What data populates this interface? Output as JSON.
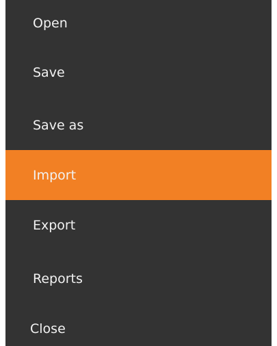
{
  "menu": {
    "items": [
      {
        "label": "Open",
        "selected": false
      },
      {
        "label": "Save",
        "selected": false
      },
      {
        "label": "Save as",
        "selected": false
      },
      {
        "label": "Import",
        "selected": true
      },
      {
        "label": "Export",
        "selected": false
      },
      {
        "label": "Reports",
        "selected": false
      },
      {
        "label": "Close",
        "selected": false
      }
    ]
  },
  "colors": {
    "panel_background": "#333333",
    "selected_background": "#f28024",
    "text": "#f2f2f2"
  }
}
